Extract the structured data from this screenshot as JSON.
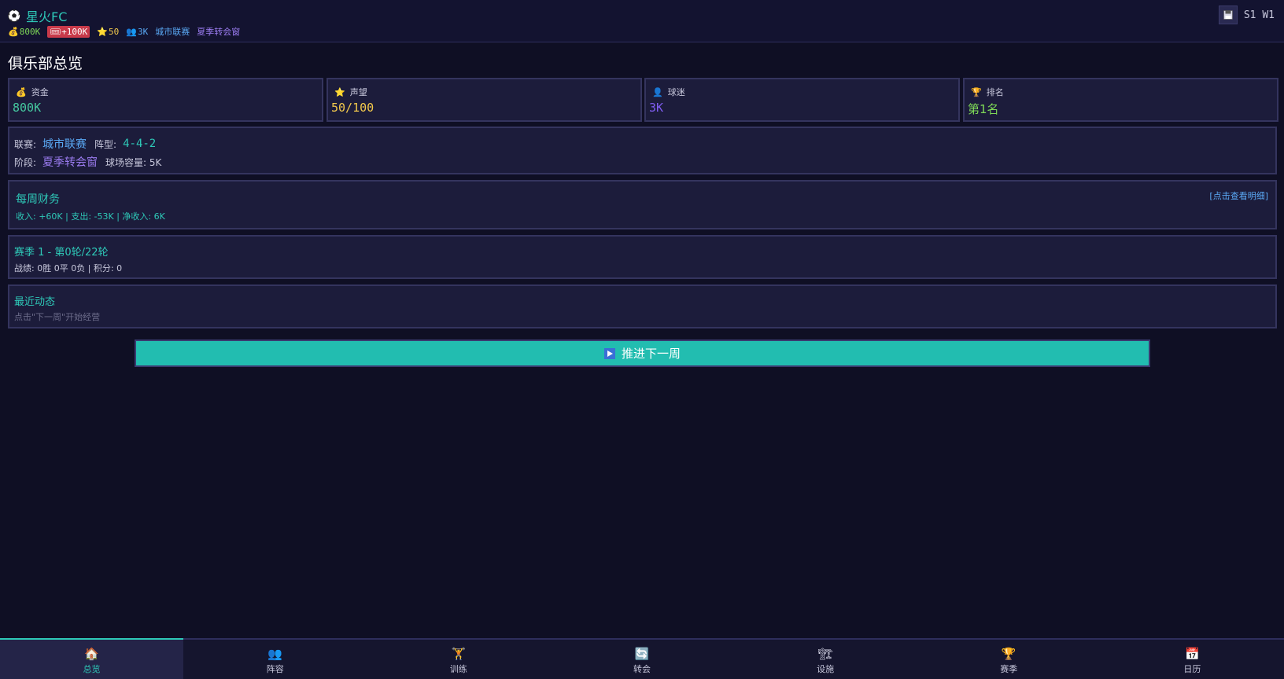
{
  "header": {
    "club_name": "星火FC",
    "stats": {
      "money": "800K",
      "debt": "+100K",
      "reputation": "50",
      "fans": "3K",
      "league": "城市联赛",
      "phase": "夏季转会窗"
    },
    "season_week": "S1 W1"
  },
  "page_title": "俱乐部总览",
  "cards": [
    {
      "label": "资金",
      "value": "800K",
      "icon": "money-bag-icon"
    },
    {
      "label": "声望",
      "value": "50/100",
      "icon": "star-icon"
    },
    {
      "label": "球迷",
      "value": "3K",
      "icon": "fans-icon"
    },
    {
      "label": "排名",
      "value": "第1名",
      "icon": "trophy-icon"
    }
  ],
  "info": {
    "league_label": "联赛:",
    "league_value": "城市联赛",
    "formation_label": "阵型:",
    "formation_value": "4-4-2",
    "phase_label": "阶段:",
    "phase_value": "夏季转会窗",
    "capacity_text": "球场容量: 5K"
  },
  "finance": {
    "title": "每周财务",
    "detail": "收入: +60K | 支出: -53K | 净收入: 6K",
    "link": "[点击查看明细]"
  },
  "season": {
    "title": "赛季 1 - 第0轮/22轮",
    "record": "战绩: 0胜 0平 0负 | 积分: 0"
  },
  "news": {
    "title": "最近动态",
    "hint": "点击\"下一周\"开始经营"
  },
  "next_week_button": "推进下一周",
  "nav": [
    {
      "label": "总览",
      "icon": "home-icon",
      "active": true
    },
    {
      "label": "阵容",
      "icon": "squad-icon",
      "active": false
    },
    {
      "label": "训练",
      "icon": "training-icon",
      "active": false
    },
    {
      "label": "转会",
      "icon": "transfer-icon",
      "active": false
    },
    {
      "label": "设施",
      "icon": "facility-icon",
      "active": false
    },
    {
      "label": "赛季",
      "icon": "trophy-icon",
      "active": false
    },
    {
      "label": "日历",
      "icon": "calendar-icon",
      "active": false
    }
  ]
}
